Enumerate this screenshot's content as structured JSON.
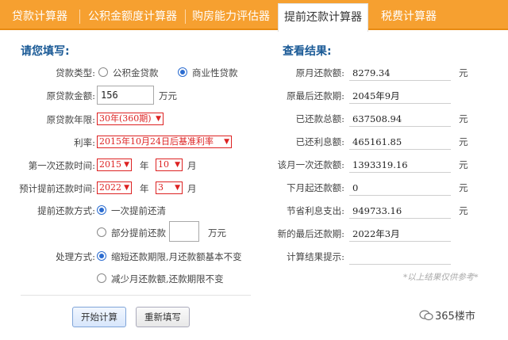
{
  "tabs": [
    {
      "label": "贷款计算器"
    },
    {
      "label": "公积金额度计算器"
    },
    {
      "label": "购房能力评估器"
    },
    {
      "label": "提前还款计算器"
    },
    {
      "label": "税费计算器"
    }
  ],
  "form": {
    "title": "请您填写:",
    "loan_type_label": "贷款类型:",
    "loan_type_option1": "公积金贷款",
    "loan_type_option2": "商业性贷款",
    "amount_label": "原贷款金额:",
    "amount_value": "156",
    "amount_unit": "万元",
    "term_label": "原贷款年限:",
    "term_value": "30年(360期)",
    "rate_label": "利率:",
    "rate_value": "2015年10月24日后基准利率",
    "first_pay_label": "第一次还款时间:",
    "first_pay_year": "2015",
    "first_pay_month": "10",
    "year_unit": "年",
    "month_unit": "月",
    "prepay_time_label": "预计提前还款时间:",
    "prepay_year": "2022",
    "prepay_month": "3",
    "prepay_method_label": "提前还款方式:",
    "prepay_method_option1": "一次提前还清",
    "prepay_method_option2": "部分提前还款",
    "partial_amount_value": "",
    "partial_amount_unit": "万元",
    "handling_label": "处理方式:",
    "handling_option1": "缩短还款期限,月还款额基本不变",
    "handling_option2": "减少月还款额,还款期限不变"
  },
  "results": {
    "title": "查看结果:",
    "unit": "元",
    "rows": [
      {
        "label": "原月还款额:",
        "value": "8279.34",
        "has_unit": true
      },
      {
        "label": "原最后还款期:",
        "value": "2045年9月",
        "has_unit": false
      },
      {
        "label": "已还款总额:",
        "value": "637508.94",
        "has_unit": true
      },
      {
        "label": "已还利息额:",
        "value": "465161.85",
        "has_unit": true
      },
      {
        "label": "该月一次还款额:",
        "value": "1393319.16",
        "has_unit": true
      },
      {
        "label": "下月起还款额:",
        "value": "0",
        "has_unit": true
      },
      {
        "label": "节省利息支出:",
        "value": "949733.16",
        "has_unit": true
      },
      {
        "label": "新的最后还款期:",
        "value": "2022年3月",
        "has_unit": false
      },
      {
        "label": "计算结果提示:",
        "value": "",
        "has_unit": false
      }
    ],
    "note": "*以上结果仅供参考*"
  },
  "buttons": {
    "calculate": "开始计算",
    "reset": "重新填写"
  },
  "watermark": "365楼市",
  "colors": {
    "tabbar": "#f6a030",
    "title": "#1a5a96",
    "select_red": "#dd2222",
    "radio_blue": "#2b6cd0"
  }
}
